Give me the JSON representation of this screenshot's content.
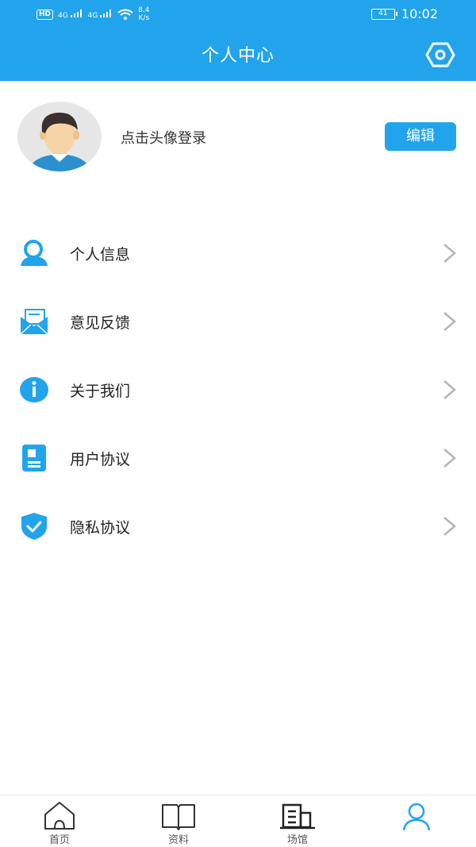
{
  "status_bar": {
    "hd_label": "HD",
    "network_1": "4G",
    "network_2": "4G",
    "speed_value": "8.4",
    "speed_unit": "K/s",
    "battery": "41",
    "time": "10:02"
  },
  "header": {
    "title": "个人中心",
    "settings_icon": "settings-hexagon-icon",
    "background_color": "#21a4ec"
  },
  "profile": {
    "login_hint": "点击头像登录",
    "edit_label": "编辑"
  },
  "menu": {
    "items": [
      {
        "label": "个人信息",
        "icon": "user-info-icon"
      },
      {
        "label": "意见反馈",
        "icon": "feedback-mail-icon"
      },
      {
        "label": "关于我们",
        "icon": "info-icon"
      },
      {
        "label": "用户协议",
        "icon": "document-icon"
      },
      {
        "label": "隐私协议",
        "icon": "shield-check-icon"
      }
    ]
  },
  "tabbar": {
    "tabs": [
      {
        "label": "首页",
        "icon": "home-icon",
        "active": false
      },
      {
        "label": "资料",
        "icon": "book-icon",
        "active": false
      },
      {
        "label": "场馆",
        "icon": "venue-icon",
        "active": false
      },
      {
        "label": "",
        "icon": "profile-icon",
        "active": true
      }
    ]
  },
  "accent_color": "#21a4ec"
}
